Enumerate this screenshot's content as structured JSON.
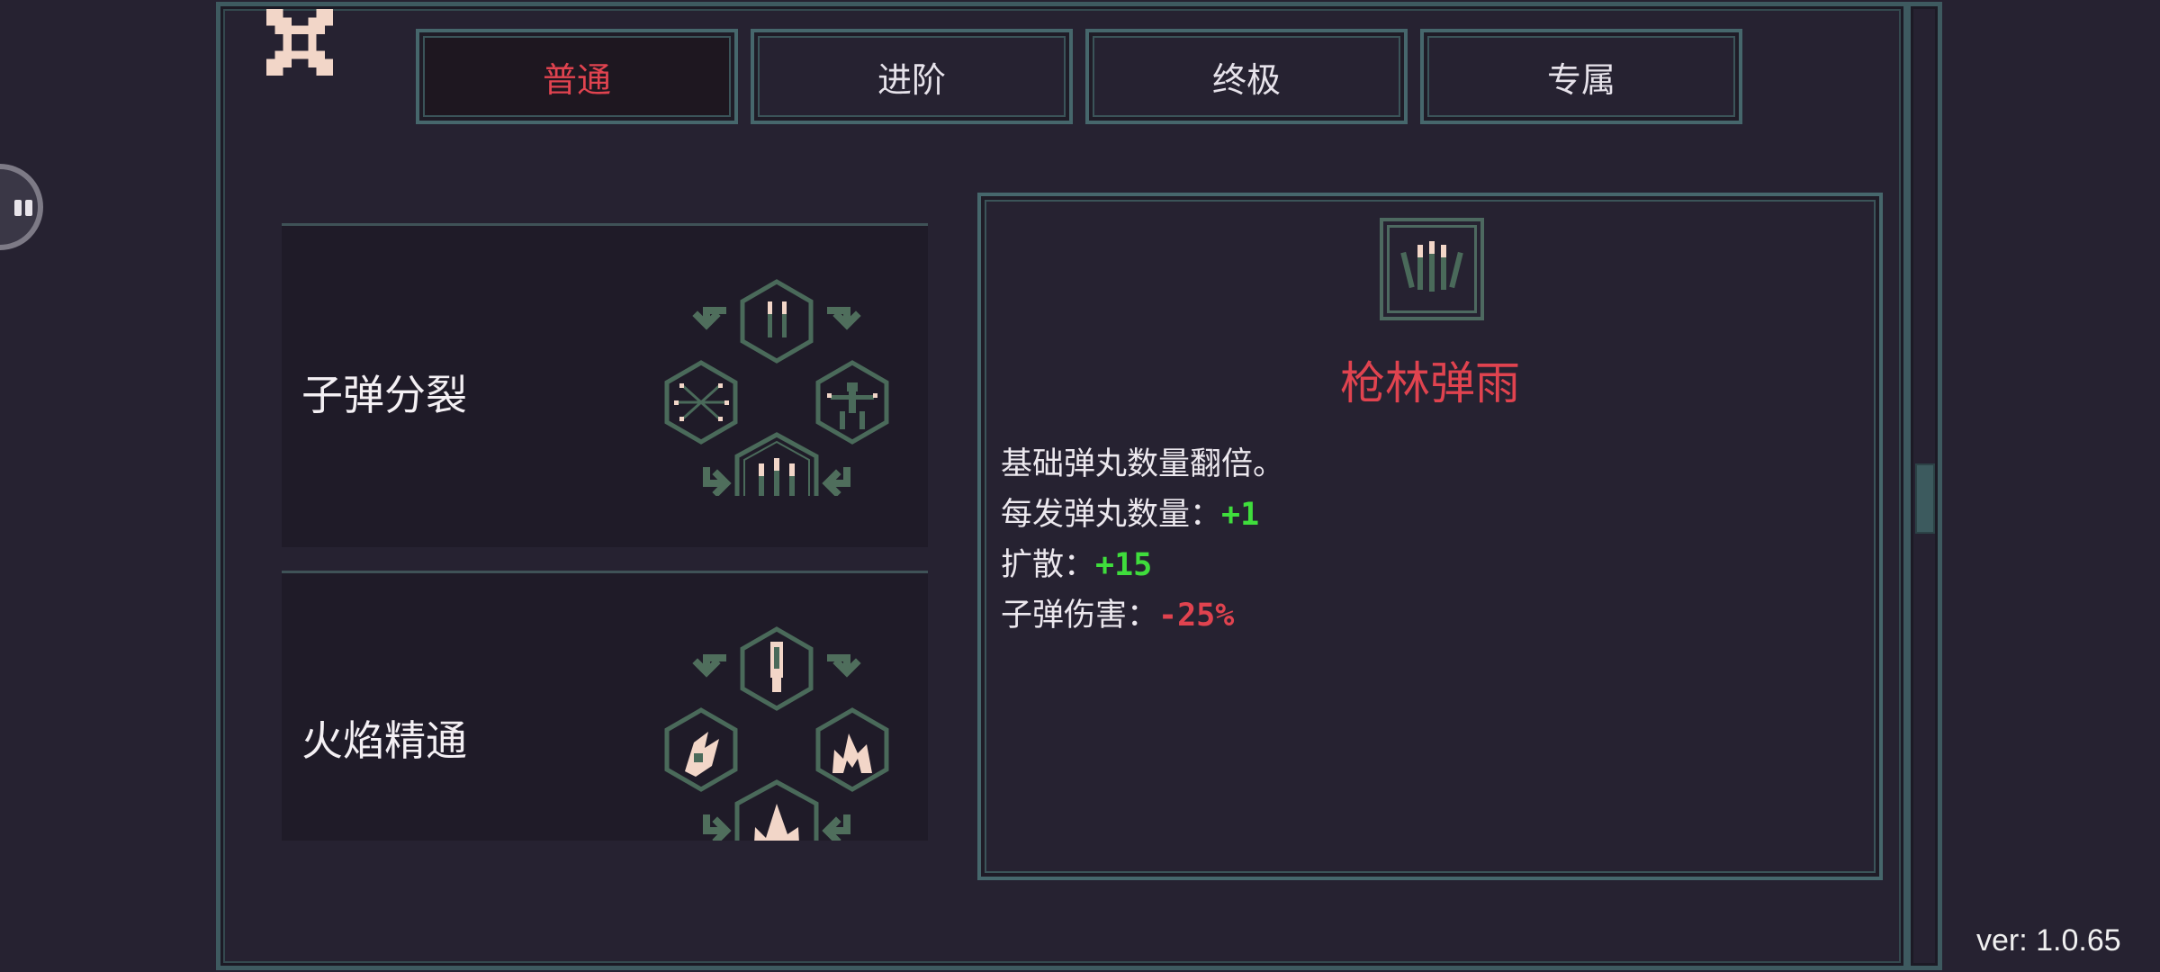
{
  "tabs": [
    {
      "label": "普通",
      "active": true
    },
    {
      "label": "进阶",
      "active": false
    },
    {
      "label": "终极",
      "active": false
    },
    {
      "label": "专属",
      "active": false
    }
  ],
  "skills": [
    {
      "title": "子弹分裂",
      "icons": [
        "twin-bullet-icon",
        "burst-icon",
        "vitruvian-icon",
        "triple-bullet-icon"
      ]
    },
    {
      "title": "火焰精通",
      "icons": [
        "rocket-icon",
        "fireball-icon",
        "flame-icon",
        "big-flame-icon"
      ]
    }
  ],
  "detail": {
    "icon": "bullet-rain-icon",
    "title": "枪林弹雨",
    "description": "基础弹丸数量翻倍。",
    "stats": [
      {
        "label": "每发弹丸数量：",
        "value": "+1",
        "color": "#3fdd3c"
      },
      {
        "label": "扩散：",
        "value": "+15",
        "color": "#3fdd3c"
      },
      {
        "label": "子弹伤害：",
        "value": "-25%",
        "color": "#e0434f"
      }
    ]
  },
  "version": "ver: 1.0.65",
  "colors": {
    "background": "#262231",
    "frame": "#3e5a60",
    "accent_red": "#e0434f",
    "accent_green": "#3fdd3c",
    "icon_light": "#f2d6c8",
    "icon_dark": "#4a6a5a"
  }
}
